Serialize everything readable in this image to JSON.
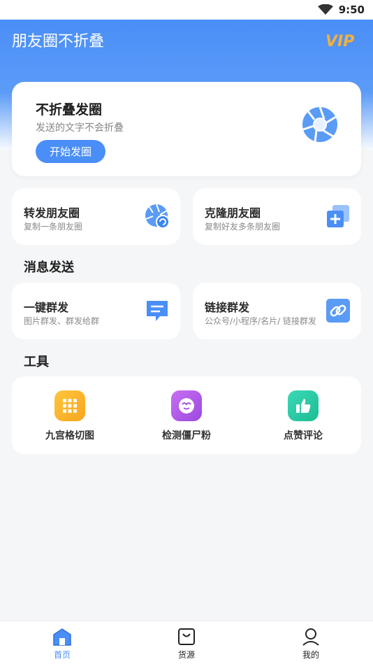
{
  "status_bar": {
    "time": "9:50",
    "wifi_icon": "wifi-icon"
  },
  "header": {
    "title": "朋友圈不折叠",
    "vip_label": "VIP",
    "accent": "#4a8ef7"
  },
  "hero": {
    "title": "不折叠发圈",
    "subtitle": "发送的文字不会折叠",
    "button_label": "开始发圈",
    "icon": "shutter-icon"
  },
  "feature_cards": [
    {
      "title": "转发朋友圈",
      "subtitle": "复制一条朋友圈",
      "icon": "shutter-refresh-icon"
    },
    {
      "title": "克隆朋友圈",
      "subtitle": "复制好友多条朋友圈",
      "icon": "clone-add-icon"
    }
  ],
  "message_section": {
    "title": "消息发送",
    "cards": [
      {
        "title": "一键群发",
        "subtitle": "图片群发、群发给群",
        "icon": "chat-bubble-icon"
      },
      {
        "title": "链接群发",
        "subtitle": "公众号/小程序/名片/ 链接群发",
        "icon": "link-icon"
      }
    ]
  },
  "tools_section": {
    "title": "工具",
    "items": [
      {
        "label": "九宫格切图",
        "icon": "grid-icon",
        "color": "#fbb42c"
      },
      {
        "label": "检测僵尸粉",
        "icon": "smile-face-icon",
        "color": "#b45ae8"
      },
      {
        "label": "点赞评论",
        "icon": "thumbs-up-icon",
        "color": "#27cba3"
      }
    ]
  },
  "bottom_nav": {
    "items": [
      {
        "label": "首页",
        "icon": "home-icon",
        "active": true
      },
      {
        "label": "货源",
        "icon": "bag-icon",
        "active": false
      },
      {
        "label": "我的",
        "icon": "user-icon",
        "active": false
      }
    ]
  }
}
